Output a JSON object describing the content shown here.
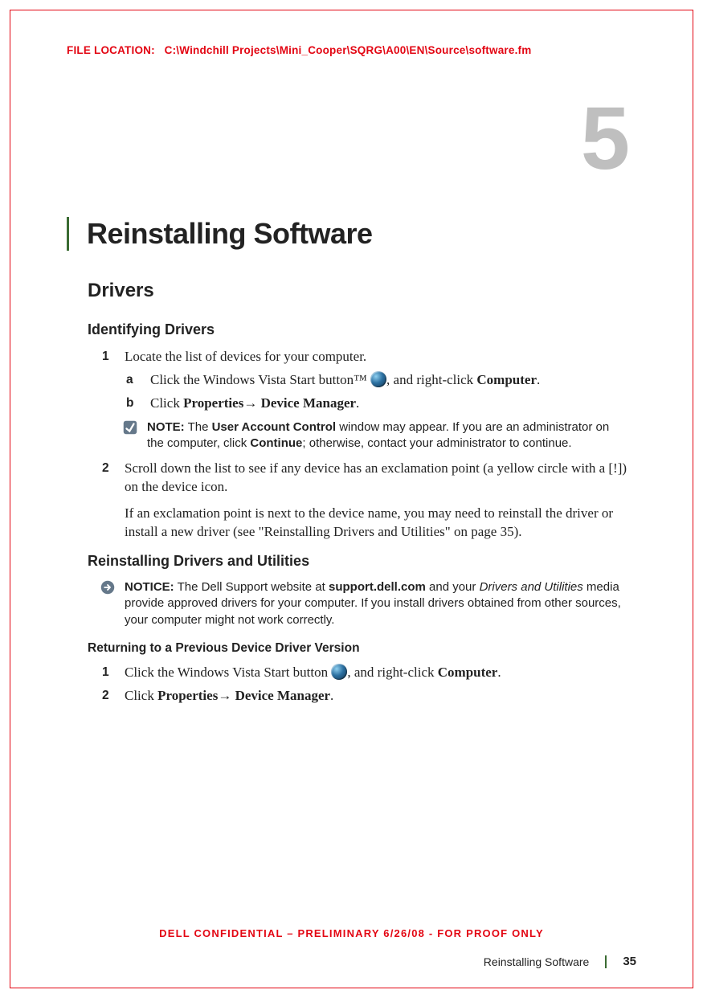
{
  "file_location_label": "FILE LOCATION:",
  "file_location_path": "C:\\Windchill Projects\\Mini_Cooper\\SQRG\\A00\\EN\\Source\\software.fm",
  "chapter_number": "5",
  "chapter_title": "Reinstalling Software",
  "section_drivers": "Drivers",
  "section_identifying": "Identifying Drivers",
  "steps": {
    "s1_num": "1",
    "s1_text": "Locate the list of devices for your computer.",
    "s1a_num": "a",
    "s1a_pre": "Click the Windows Vista Start button™ ",
    "s1a_post": ", and right-click ",
    "s1a_bold": "Computer",
    "s1a_end": ".",
    "s1b_num": "b",
    "s1b_pre": "Click ",
    "s1b_bold1": "Properties",
    "s1b_arrow": "→ ",
    "s1b_bold2": "Device Manager",
    "s1b_end": ".",
    "s2_num": "2",
    "s2_text": "Scroll down the list to see if any device has an exclamation point (a yellow circle with a [!]) on the device icon.",
    "s2_para": "If an exclamation point is next to the device name, you may need to reinstall the driver or install a new driver (see \"Reinstalling Drivers and Utilities\" on page 35)."
  },
  "note": {
    "label": "NOTE:",
    "pre": " The ",
    "b1": "User Account Control",
    "mid": " window may appear. If you are an administrator on the computer, click ",
    "b2": "Continue",
    "post": "; otherwise, contact your administrator to continue."
  },
  "section_reinstalling": "Reinstalling Drivers and Utilities",
  "notice": {
    "label": "NOTICE:",
    "pre": " The Dell Support website at ",
    "b1": "support.dell.com",
    "mid": " and your ",
    "i1": "Drivers and Utilities",
    "post": " media provide approved drivers for your computer. If you install drivers obtained from other sources, your computer might not work correctly."
  },
  "section_returning": "Returning to a Previous Device Driver Version",
  "ret_steps": {
    "s1_num": "1",
    "s1_pre": "Click the Windows Vista Start button ",
    "s1_post": ", and right-click ",
    "s1_bold": "Computer",
    "s1_end": ".",
    "s2_num": "2",
    "s2_pre": "Click ",
    "s2_b1": "Properties",
    "s2_arrow": "→ ",
    "s2_b2": "Device Manager",
    "s2_end": "."
  },
  "footer_confidential": "DELL CONFIDENTIAL – PRELIMINARY 6/26/08 - FOR PROOF ONLY",
  "footer_title": "Reinstalling Software",
  "footer_page": "35"
}
